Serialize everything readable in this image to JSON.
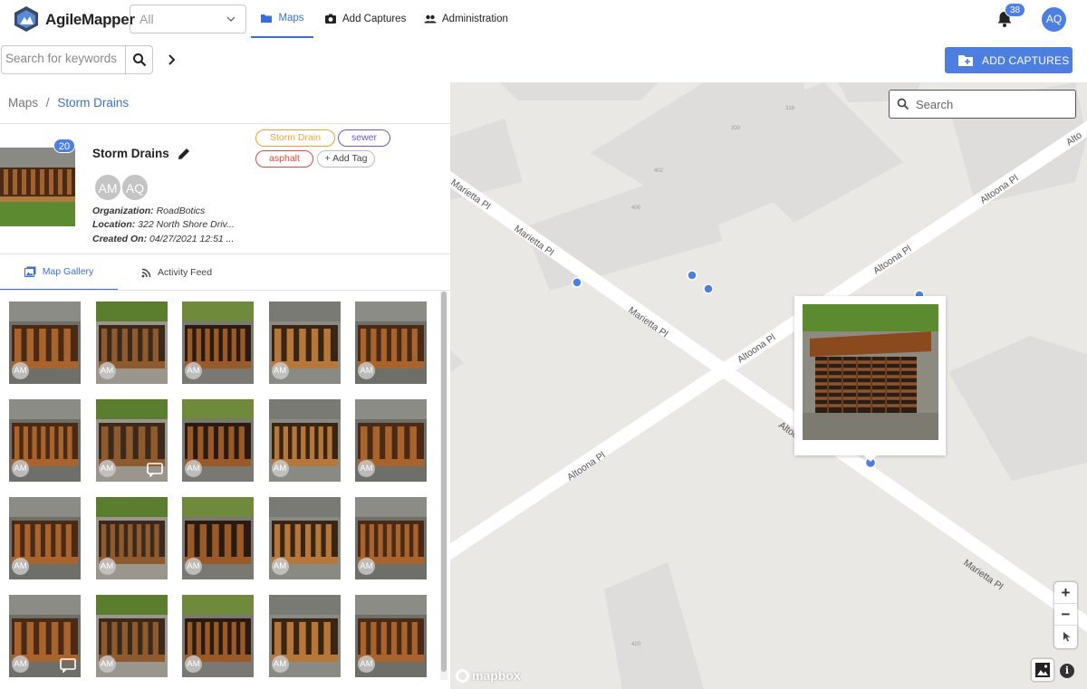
{
  "app": {
    "brand": "AgileMapper"
  },
  "header": {
    "filter_value": "All",
    "tabs": [
      {
        "label": "Maps",
        "icon": "folder-icon",
        "active": true
      },
      {
        "label": "Add Captures",
        "icon": "camera-icon",
        "active": false
      },
      {
        "label": "Administration",
        "icon": "people-icon",
        "active": false
      }
    ],
    "notification_count": "38",
    "user_initials": "AQ"
  },
  "toolbar": {
    "search_placeholder": "Search for keywords",
    "add_captures_label": "ADD CAPTURES"
  },
  "breadcrumb": {
    "root": "Maps",
    "separator": "/",
    "current": "Storm Drains"
  },
  "map_info": {
    "title": "Storm Drains",
    "capture_count": "20",
    "members": [
      "AM",
      "AQ"
    ],
    "organization_label": "Organization:",
    "organization": "RoadBotics",
    "location_label": "Location:",
    "location": "322 North Shore Driv...",
    "created_label": "Created On:",
    "created": "04/27/2021 12:51 ...",
    "tags": [
      {
        "label": "Storm Drain",
        "color": "#f0a23a"
      },
      {
        "label": "sewer",
        "color": "#6a5acd"
      },
      {
        "label": "asphalt",
        "color": "#e24a3b"
      }
    ],
    "add_tag_label": "+ Add Tag"
  },
  "panel_tabs": [
    {
      "label": "Map Gallery",
      "icon": "gallery-icon",
      "active": true
    },
    {
      "label": "Activity Feed",
      "icon": "rss-icon",
      "active": false
    }
  ],
  "gallery": [
    {
      "initials": "AM",
      "comment": false
    },
    {
      "initials": "AM",
      "comment": false
    },
    {
      "initials": "AM",
      "comment": false
    },
    {
      "initials": "AM",
      "comment": false
    },
    {
      "initials": "AM",
      "comment": false
    },
    {
      "initials": "AM",
      "comment": false
    },
    {
      "initials": "AM",
      "comment": true
    },
    {
      "initials": "AM",
      "comment": false
    },
    {
      "initials": "AM",
      "comment": false
    },
    {
      "initials": "AM",
      "comment": false
    },
    {
      "initials": "AM",
      "comment": false
    },
    {
      "initials": "AM",
      "comment": false
    },
    {
      "initials": "AM",
      "comment": false
    },
    {
      "initials": "AM",
      "comment": false
    },
    {
      "initials": "AM",
      "comment": false
    },
    {
      "initials": "AM",
      "comment": true
    },
    {
      "initials": "AM",
      "comment": false
    },
    {
      "initials": "AM",
      "comment": false
    },
    {
      "initials": "AM",
      "comment": false
    },
    {
      "initials": "AM",
      "comment": false
    }
  ],
  "map": {
    "search_placeholder": "Search",
    "street_labels": [
      "Marietta Pl",
      "Marietta Pl",
      "Marietta Pl",
      "Marietta Pl",
      "Altoona Pl",
      "Altoona Pl",
      "Altoona Pl",
      "Altoona Pl",
      "Altoona Pl",
      "Alto"
    ],
    "building_numbers": [
      "316",
      "300",
      "402",
      "400",
      "420"
    ],
    "attribution": "mapbox",
    "zoom_in": "+",
    "zoom_out": "−",
    "info": "i"
  },
  "colors": {
    "accent": "#4c7fe0",
    "link": "#3b6fd8",
    "map_bg": "#e9e8e4",
    "road": "#ffffff",
    "building": "#dedddb"
  }
}
